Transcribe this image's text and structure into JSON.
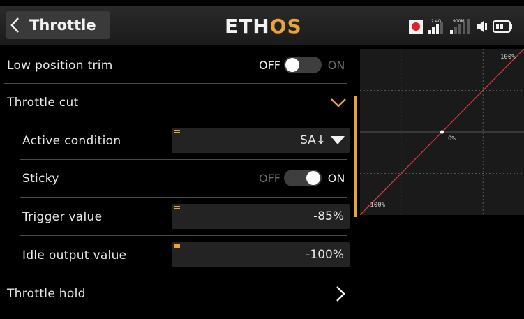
{
  "header": {
    "title": "Throttle",
    "logo_part1": "ETH",
    "logo_part2": "OS",
    "status": {
      "rf_band": "2.4G",
      "telemetry_band": "900M"
    }
  },
  "rows": {
    "low_trim": {
      "label": "Low position trim",
      "off": "OFF",
      "on": "ON",
      "state": "off"
    },
    "throttle_cut": {
      "label": "Throttle cut",
      "expanded": true
    },
    "active_condition": {
      "label": "Active condition",
      "value": "SA↓"
    },
    "sticky": {
      "label": "Sticky",
      "off": "OFF",
      "on": "ON",
      "state": "on"
    },
    "trigger": {
      "label": "Trigger value",
      "value": "-85%"
    },
    "idle": {
      "label": "Idle output value",
      "value": "-100%"
    },
    "throttle_hold": {
      "label": "Throttle hold"
    }
  },
  "graph": {
    "label_max": "100%",
    "label_center": "0%",
    "label_min": "-100%",
    "curve": {
      "x": [
        -100,
        100
      ],
      "y": [
        -100,
        100
      ]
    },
    "cursor_x": 0,
    "point": {
      "x": 0,
      "y": 0
    }
  },
  "colors": {
    "accent": "#e8a33c",
    "curve": "#d43b3b",
    "cursor": "#e8a33c",
    "rec": "#e0202a"
  }
}
